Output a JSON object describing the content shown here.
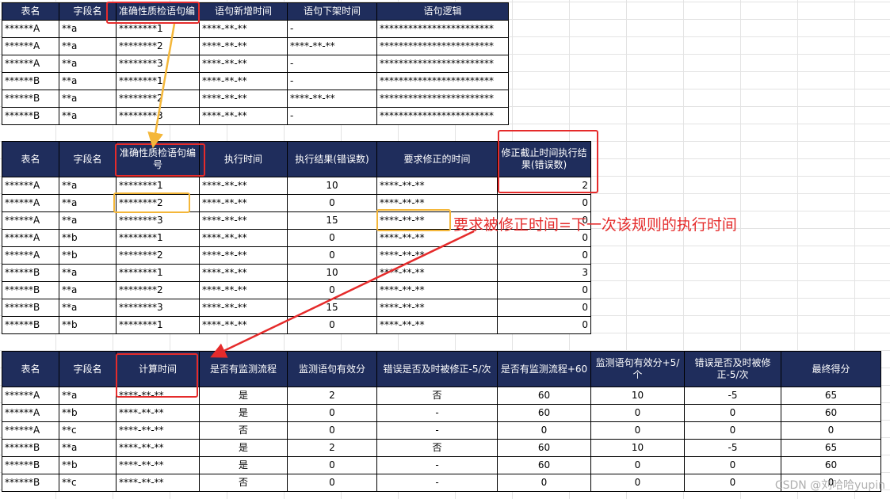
{
  "table1": {
    "headers": [
      "表名",
      "字段名",
      "准确性质检语句编",
      "语句新增时间",
      "语句下架时间",
      "语句逻辑"
    ],
    "rows": [
      [
        "******A",
        "**a",
        "********1",
        "****-**-**",
        "-",
        "************************"
      ],
      [
        "******A",
        "**a",
        "********2",
        "****-**-**",
        "****-**-**",
        "************************"
      ],
      [
        "******A",
        "**a",
        "********3",
        "****-**-**",
        "-",
        "************************"
      ],
      [
        "******B",
        "**a",
        "********1",
        "****-**-**",
        "-",
        "************************"
      ],
      [
        "******B",
        "**a",
        "********2",
        "****-**-**",
        "****-**-**",
        "************************"
      ],
      [
        "******B",
        "**a",
        "********3",
        "****-**-**",
        "-",
        "************************"
      ]
    ]
  },
  "table2": {
    "headers": [
      "表名",
      "字段名",
      "准确性质检语句编号",
      "执行时间",
      "执行结果(错误数)",
      "要求修正的时间",
      "修正截止时间执行结果(错误数)"
    ],
    "rows": [
      [
        "******A",
        "**a",
        "********1",
        "****-**-**",
        "10",
        "****-**-**",
        "2"
      ],
      [
        "******A",
        "**a",
        "********2",
        "****-**-**",
        "0",
        "****-**-**",
        "0"
      ],
      [
        "******A",
        "**a",
        "********3",
        "****-**-**",
        "15",
        "****-**-**",
        "0"
      ],
      [
        "******A",
        "**b",
        "********1",
        "****-**-**",
        "0",
        "****-**-**",
        "0"
      ],
      [
        "******A",
        "**b",
        "********2",
        "****-**-**",
        "0",
        "****-**-**",
        "0"
      ],
      [
        "******B",
        "**a",
        "********1",
        "****-**-**",
        "10",
        "****-**-**",
        "3"
      ],
      [
        "******B",
        "**a",
        "********2",
        "****-**-**",
        "0",
        "****-**-**",
        "0"
      ],
      [
        "******B",
        "**a",
        "********3",
        "****-**-**",
        "15",
        "****-**-**",
        "0"
      ],
      [
        "******B",
        "**b",
        "********1",
        "****-**-**",
        "0",
        "****-**-**",
        "0"
      ]
    ]
  },
  "table3": {
    "headers": [
      "表名",
      "字段名",
      "计算时间",
      "是否有监测流程",
      "监测语句有效分",
      "错误是否及时被修正-5/次",
      "是否有监测流程+60",
      "监测语句有效分+5/个",
      "错误是否及时被修正-5/次",
      "最终得分"
    ],
    "rows": [
      [
        "******A",
        "**a",
        "****-**-**",
        "是",
        "2",
        "否",
        "60",
        "10",
        "-5",
        "65"
      ],
      [
        "******A",
        "**b",
        "****-**-**",
        "是",
        "0",
        "-",
        "60",
        "0",
        "0",
        "60"
      ],
      [
        "******A",
        "**c",
        "****-**-**",
        "否",
        "0",
        "-",
        "0",
        "0",
        "0",
        "0"
      ],
      [
        "******B",
        "**a",
        "****-**-**",
        "是",
        "2",
        "否",
        "60",
        "10",
        "-5",
        "65"
      ],
      [
        "******B",
        "**b",
        "****-**-**",
        "是",
        "0",
        "-",
        "60",
        "0",
        "0",
        "60"
      ],
      [
        "******B",
        "**c",
        "****-**-**",
        "否",
        "0",
        "-",
        "0",
        "0",
        "0",
        "0"
      ]
    ]
  },
  "annotation": "要求被修正时间=下一次该规则的执行时间",
  "watermark": "CSDN @刘哈哈yupin",
  "colors": {
    "header_bg": "#1f2d5c",
    "header_text": "#ffffff",
    "highlight_red": "#e52b2b",
    "highlight_orange": "#f4b73a"
  }
}
